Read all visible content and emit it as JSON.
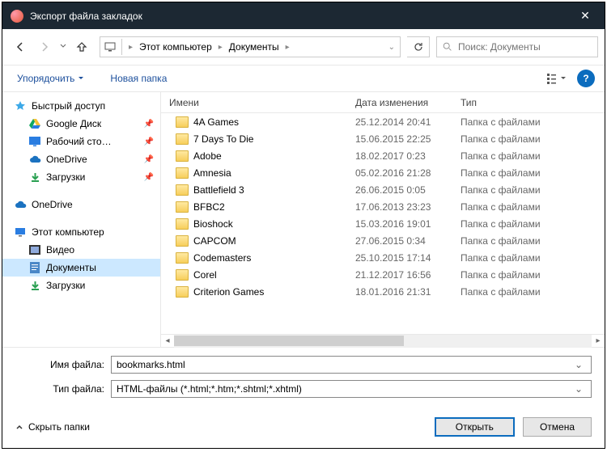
{
  "title": "Экспорт файла закладок",
  "breadcrumb": {
    "root": "Этот компьютер",
    "folder": "Документы"
  },
  "search": {
    "placeholder": "Поиск: Документы"
  },
  "toolbar": {
    "organize": "Упорядочить",
    "newfolder": "Новая папка"
  },
  "sidebar": {
    "quick": "Быстрый доступ",
    "gdrive": "Google Диск",
    "desktop": "Рабочий сто…",
    "onedrive1": "OneDrive",
    "downloads1": "Загрузки",
    "onedrive2": "OneDrive",
    "thispc": "Этот компьютер",
    "videos": "Видео",
    "documents": "Документы",
    "downloads2": "Загрузки"
  },
  "columns": {
    "name": "Имени",
    "date": "Дата изменения",
    "type": "Тип"
  },
  "type_folder": "Папка с файлами",
  "files": [
    {
      "n": "4A Games",
      "d": "25.12.2014 20:41"
    },
    {
      "n": "7 Days To Die",
      "d": "15.06.2015 22:25"
    },
    {
      "n": "Adobe",
      "d": "18.02.2017 0:23"
    },
    {
      "n": "Amnesia",
      "d": "05.02.2016 21:28"
    },
    {
      "n": "Battlefield 3",
      "d": "26.06.2015 0:05"
    },
    {
      "n": "BFBC2",
      "d": "17.06.2013 23:23"
    },
    {
      "n": "Bioshock",
      "d": "15.03.2016 19:01"
    },
    {
      "n": "CAPCOM",
      "d": "27.06.2015 0:34"
    },
    {
      "n": "Codemasters",
      "d": "25.10.2015 17:14"
    },
    {
      "n": "Corel",
      "d": "21.12.2017 16:56"
    },
    {
      "n": "Criterion Games",
      "d": "18.01.2016 21:31"
    }
  ],
  "form": {
    "name_label": "Имя файла:",
    "name_value": "bookmarks.html",
    "type_label": "Тип файла:",
    "type_value": "HTML-файлы (*.html;*.htm;*.shtml;*.xhtml)"
  },
  "footer": {
    "hide": "Скрыть папки",
    "open": "Открыть",
    "cancel": "Отмена"
  }
}
